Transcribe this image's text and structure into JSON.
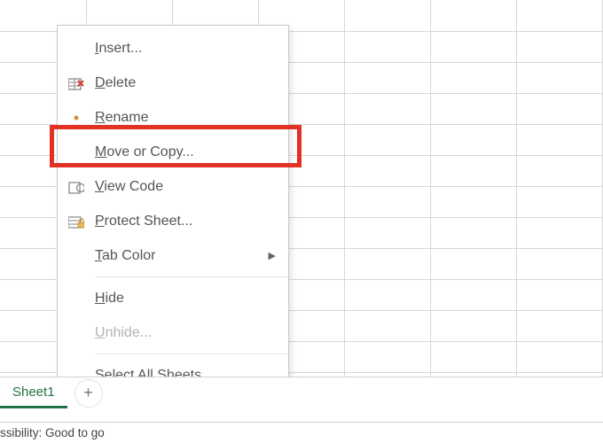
{
  "menu": {
    "insert": "Insert...",
    "delete": "Delete",
    "rename": "Rename",
    "move_or_copy": "Move or Copy...",
    "view_code": "View Code",
    "protect_sheet": "Protect Sheet...",
    "tab_color": "Tab Color",
    "hide": "Hide",
    "unhide": "Unhide...",
    "select_all": "Select All Sheets"
  },
  "sheet_tab": {
    "active": "Sheet1"
  },
  "status": {
    "accessibility": "ssibility: Good to go"
  },
  "unsaved_marker": "•"
}
